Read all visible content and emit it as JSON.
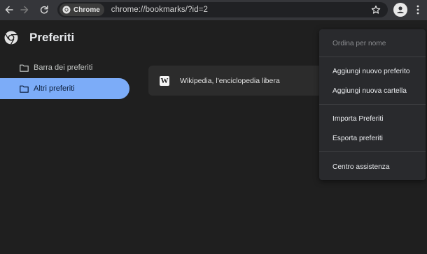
{
  "toolbar": {
    "chip_label": "Chrome",
    "url": "chrome://bookmarks/?id=2"
  },
  "header": {
    "title": "Preferiti"
  },
  "sidebar": {
    "items": [
      {
        "label": "Barra dei preferiti",
        "active": false
      },
      {
        "label": "Altri preferiti",
        "active": true
      }
    ]
  },
  "bookmarks": [
    {
      "favicon": "W",
      "title": "Wikipedia, l'enciclopedia libera"
    }
  ],
  "menu": {
    "sort": "Ordina per nome",
    "add_bookmark": "Aggiungi nuovo preferito",
    "add_folder": "Aggiungi nuova cartella",
    "import": "Importa Preferiti",
    "export": "Esporta preferiti",
    "help": "Centro assistenza"
  },
  "colors": {
    "background": "#1f1f1f",
    "toolbar": "#35363a",
    "accent": "#7cacf8",
    "card": "#2c2c2c",
    "menu": "#292a2d"
  },
  "icons": [
    "back-arrow-icon",
    "forward-arrow-icon",
    "reload-icon",
    "chrome-logo-icon",
    "star-icon",
    "profile-icon",
    "more-vert-icon",
    "folder-icon",
    "wikipedia-favicon-icon"
  ]
}
